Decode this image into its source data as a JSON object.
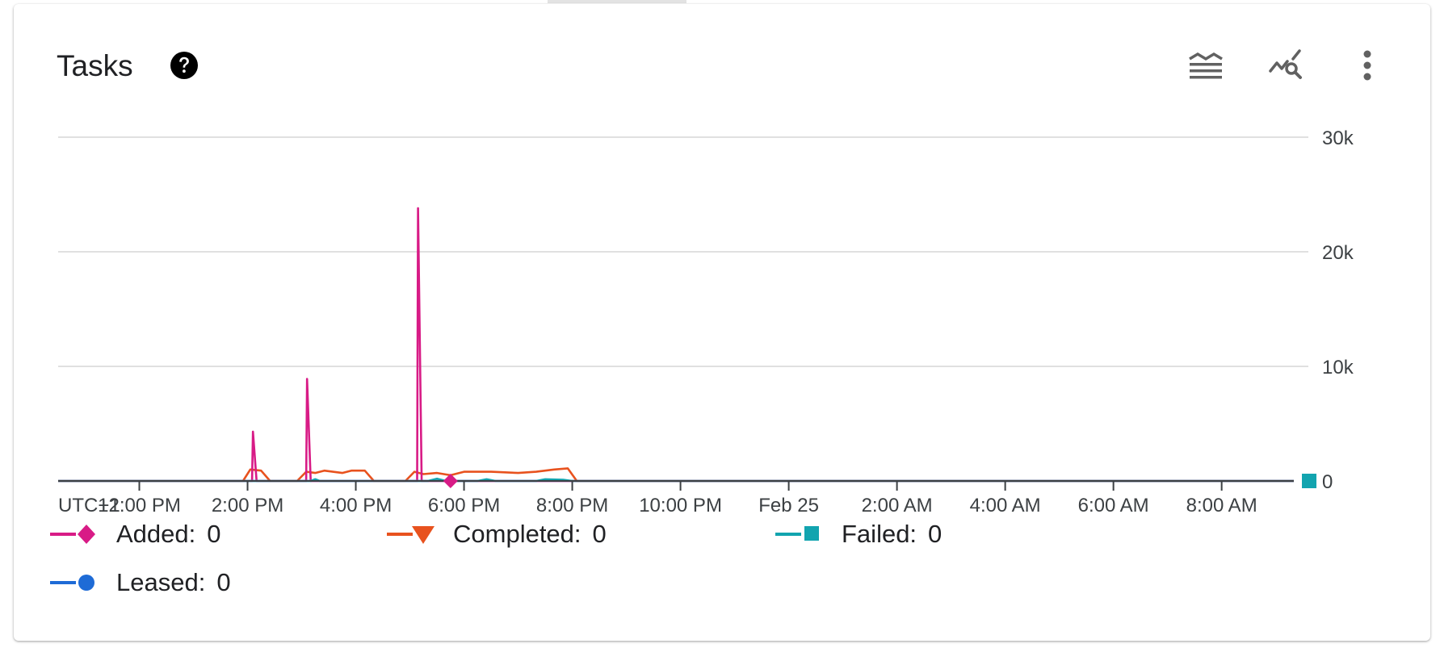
{
  "card": {
    "title": "Tasks",
    "help_icon": "help-circle-icon",
    "toolbar_icons": [
      "legend-toggle-icon",
      "explore-chart-icon",
      "more-vert-icon"
    ]
  },
  "chart_data": {
    "type": "line",
    "timezone_label": "UTC+1",
    "x_tick_labels": [
      "12:00 PM",
      "2:00 PM",
      "4:00 PM",
      "6:00 PM",
      "8:00 PM",
      "10:00 PM",
      "Feb 25",
      "2:00 AM",
      "4:00 AM",
      "6:00 AM",
      "8:00 AM"
    ],
    "x_range": [
      "Feb 24 10:30 AM",
      "Feb 25 9:20 AM"
    ],
    "y_tick_labels": [
      "0",
      "10k",
      "20k",
      "30k"
    ],
    "y_ticks": [
      0,
      10000,
      20000,
      30000
    ],
    "ylim": [
      0,
      30000
    ],
    "grid": true,
    "legend_position": "bottom",
    "series": [
      {
        "name": "Added",
        "color": "#d81b86",
        "marker": "diamond",
        "current_value": "0",
        "points": [
          [
            "Feb 24 10:30 AM",
            0
          ],
          [
            "Feb 24 2:05 PM",
            0
          ],
          [
            "Feb 24 2:06 PM",
            4300
          ],
          [
            "Feb 24 2:10 PM",
            0
          ],
          [
            "Feb 24 3:05 PM",
            0
          ],
          [
            "Feb 24 3:06 PM",
            8900
          ],
          [
            "Feb 24 3:10 PM",
            0
          ],
          [
            "Feb 24 5:08 PM",
            0
          ],
          [
            "Feb 24 5:09 PM",
            23800
          ],
          [
            "Feb 24 5:13 PM",
            0
          ],
          [
            "Feb 25 9:20 AM",
            0
          ]
        ]
      },
      {
        "name": "Completed",
        "color": "#e8521e",
        "marker": "triangle-down",
        "current_value": "0",
        "points": [
          [
            "Feb 24 10:30 AM",
            0
          ],
          [
            "Feb 24 1:55 PM",
            0
          ],
          [
            "Feb 24 2:03 PM",
            1000
          ],
          [
            "Feb 24 2:15 PM",
            900
          ],
          [
            "Feb 24 2:25 PM",
            0
          ],
          [
            "Feb 24 2:55 PM",
            0
          ],
          [
            "Feb 24 3:05 PM",
            800
          ],
          [
            "Feb 24 3:15 PM",
            700
          ],
          [
            "Feb 24 3:25 PM",
            900
          ],
          [
            "Feb 24 3:45 PM",
            700
          ],
          [
            "Feb 24 3:55 PM",
            900
          ],
          [
            "Feb 24 4:10 PM",
            900
          ],
          [
            "Feb 24 4:20 PM",
            0
          ],
          [
            "Feb 24 4:55 PM",
            0
          ],
          [
            "Feb 24 5:05 PM",
            800
          ],
          [
            "Feb 24 5:15 PM",
            600
          ],
          [
            "Feb 24 5:30 PM",
            700
          ],
          [
            "Feb 24 5:45 PM",
            500
          ],
          [
            "Feb 24 6:00 PM",
            800
          ],
          [
            "Feb 24 6:30 PM",
            800
          ],
          [
            "Feb 24 7:00 PM",
            700
          ],
          [
            "Feb 24 7:20 PM",
            800
          ],
          [
            "Feb 24 7:40 PM",
            1000
          ],
          [
            "Feb 24 7:55 PM",
            1100
          ],
          [
            "Feb 24 8:05 PM",
            0
          ],
          [
            "Feb 25 9:20 AM",
            0
          ]
        ]
      },
      {
        "name": "Failed",
        "color": "#12a4af",
        "marker": "square",
        "current_value": "0",
        "points": [
          [
            "Feb 24 10:30 AM",
            0
          ],
          [
            "Feb 24 3:10 PM",
            0
          ],
          [
            "Feb 24 3:15 PM",
            150
          ],
          [
            "Feb 24 3:20 PM",
            0
          ],
          [
            "Feb 24 5:20 PM",
            0
          ],
          [
            "Feb 24 5:30 PM",
            200
          ],
          [
            "Feb 24 5:40 PM",
            0
          ],
          [
            "Feb 24 6:15 PM",
            0
          ],
          [
            "Feb 24 6:25 PM",
            150
          ],
          [
            "Feb 24 6:35 PM",
            0
          ],
          [
            "Feb 24 7:20 PM",
            0
          ],
          [
            "Feb 24 7:30 PM",
            150
          ],
          [
            "Feb 24 7:50 PM",
            100
          ],
          [
            "Feb 24 8:00 PM",
            0
          ],
          [
            "Feb 25 9:20 AM",
            0
          ]
        ]
      },
      {
        "name": "Leased",
        "color": "#1e6bd6",
        "marker": "circle",
        "current_value": "0",
        "points": [
          [
            "Feb 24 10:30 AM",
            0
          ],
          [
            "Feb 25 9:20 AM",
            0
          ]
        ]
      }
    ]
  }
}
